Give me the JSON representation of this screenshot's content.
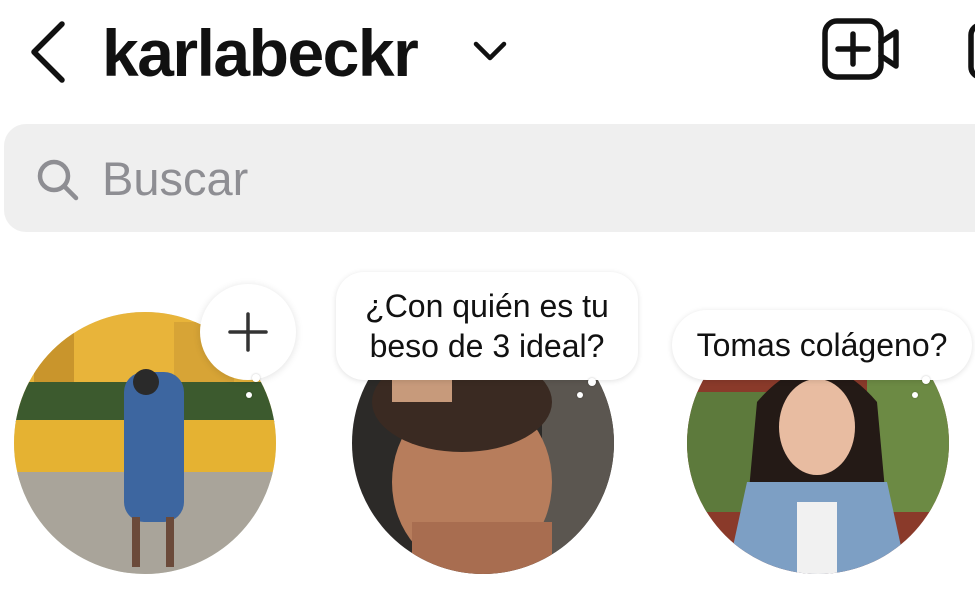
{
  "header": {
    "username": "karlabeckr",
    "icons": {
      "back": "chevron-left-icon",
      "account_switch": "chevron-down-icon",
      "new_video": "video-plus-icon"
    }
  },
  "search": {
    "placeholder": "Buscar",
    "value": ""
  },
  "notes": [
    {
      "owner": "own",
      "text": "",
      "icon": "plus-icon"
    },
    {
      "owner": "contact-2",
      "text_lines": [
        "¿Con quién es tu",
        "beso de 3 ideal?"
      ]
    },
    {
      "owner": "contact-3",
      "text": "Tomas colágeno?"
    }
  ],
  "colors": {
    "background": "#ffffff",
    "search_bg": "#efefef",
    "placeholder": "#8e8e93",
    "text": "#111111"
  }
}
